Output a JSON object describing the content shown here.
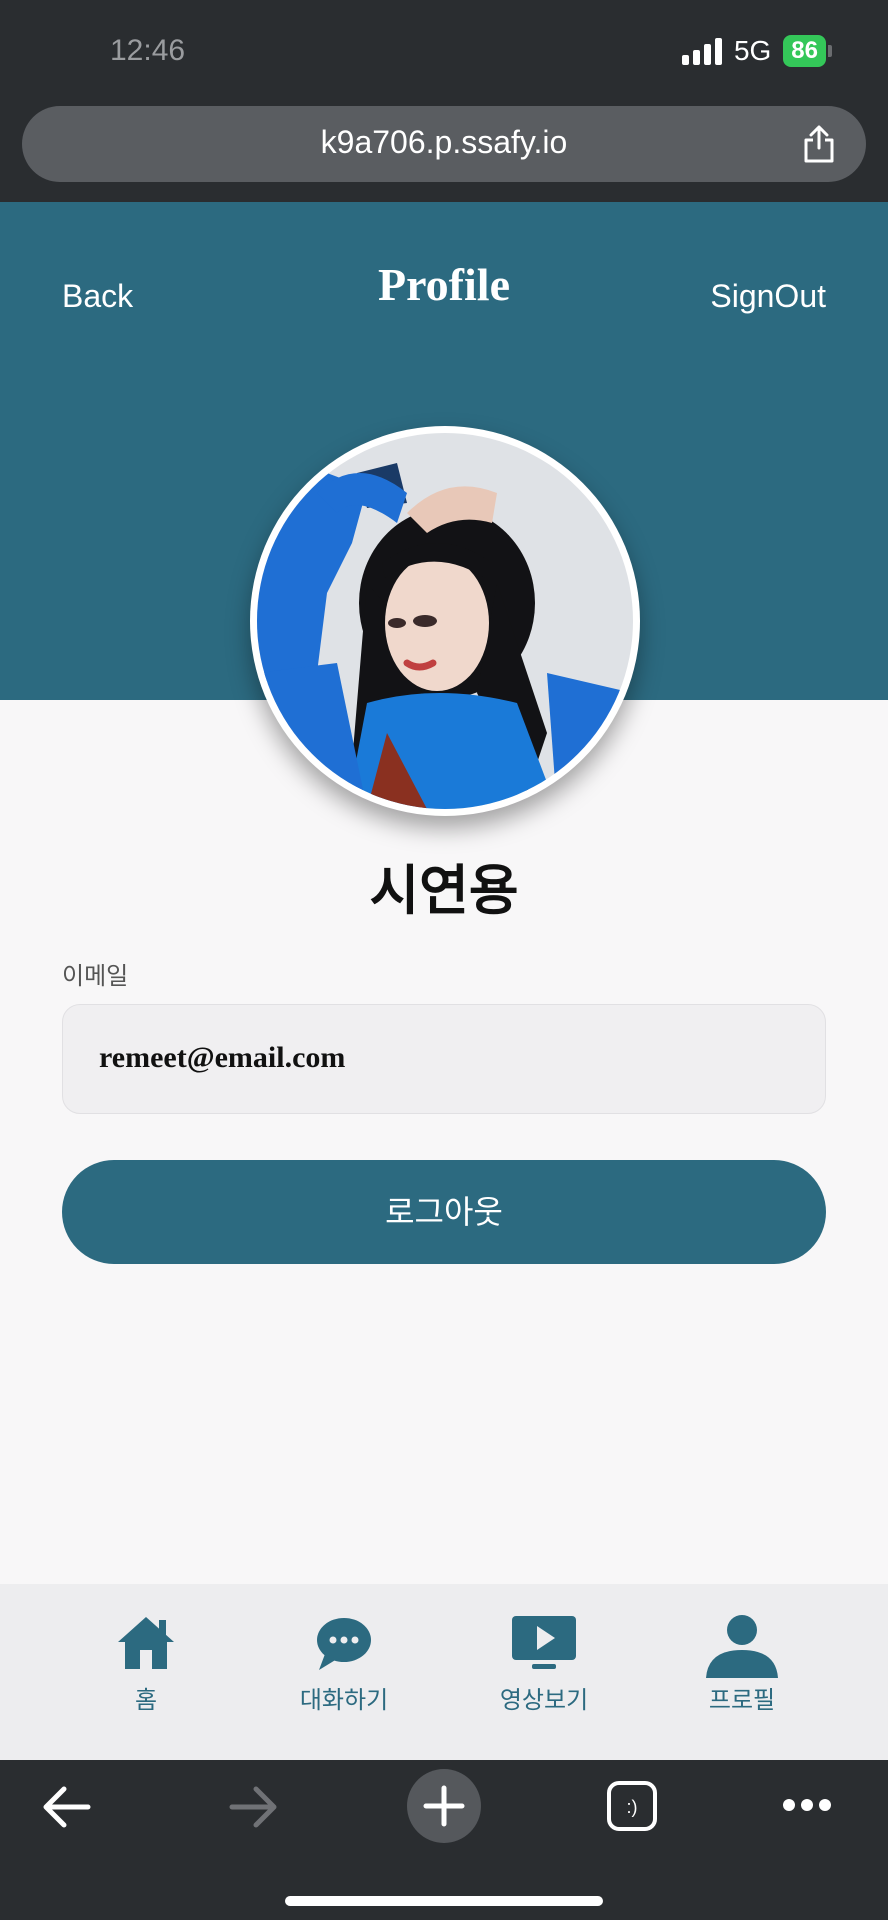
{
  "status_bar": {
    "time": "12:46",
    "network": "5G",
    "battery": "86"
  },
  "browser": {
    "url": "k9a706.p.ssafy.io"
  },
  "header": {
    "back_label": "Back",
    "title": "Profile",
    "signout_label": "SignOut"
  },
  "profile": {
    "name": "시연용",
    "email_label": "이메일",
    "email_value": "remeet@email.com",
    "logout_label": "로그아웃"
  },
  "bottom_nav": {
    "items": [
      {
        "label": "홈",
        "icon": "home-icon"
      },
      {
        "label": "대화하기",
        "icon": "chat-icon"
      },
      {
        "label": "영상보기",
        "icon": "video-play-icon"
      },
      {
        "label": "프로필",
        "icon": "person-icon"
      }
    ]
  },
  "colors": {
    "primary": "#2c6a80",
    "background": "#f8f7f8",
    "browser_chrome": "#2a2d30",
    "battery_green": "#34c759"
  }
}
